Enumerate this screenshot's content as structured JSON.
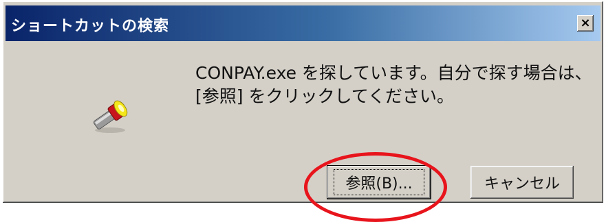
{
  "dialog": {
    "title": "ショートカットの検索",
    "close_label": "×",
    "message_line1": "CONPAY.exe を探しています。自分で探す場合は、",
    "message_line2": "[参照] をクリックしてください。",
    "icon": "flashlight-icon"
  },
  "buttons": {
    "browse_label": "参照(B)...",
    "cancel_label": "キャンセル"
  },
  "annotation": {
    "highlight_color": "#e8141c"
  },
  "colors": {
    "title_start": "#0a246a",
    "title_end": "#a6caf0",
    "dialog_bg": "#d4d0c8"
  }
}
